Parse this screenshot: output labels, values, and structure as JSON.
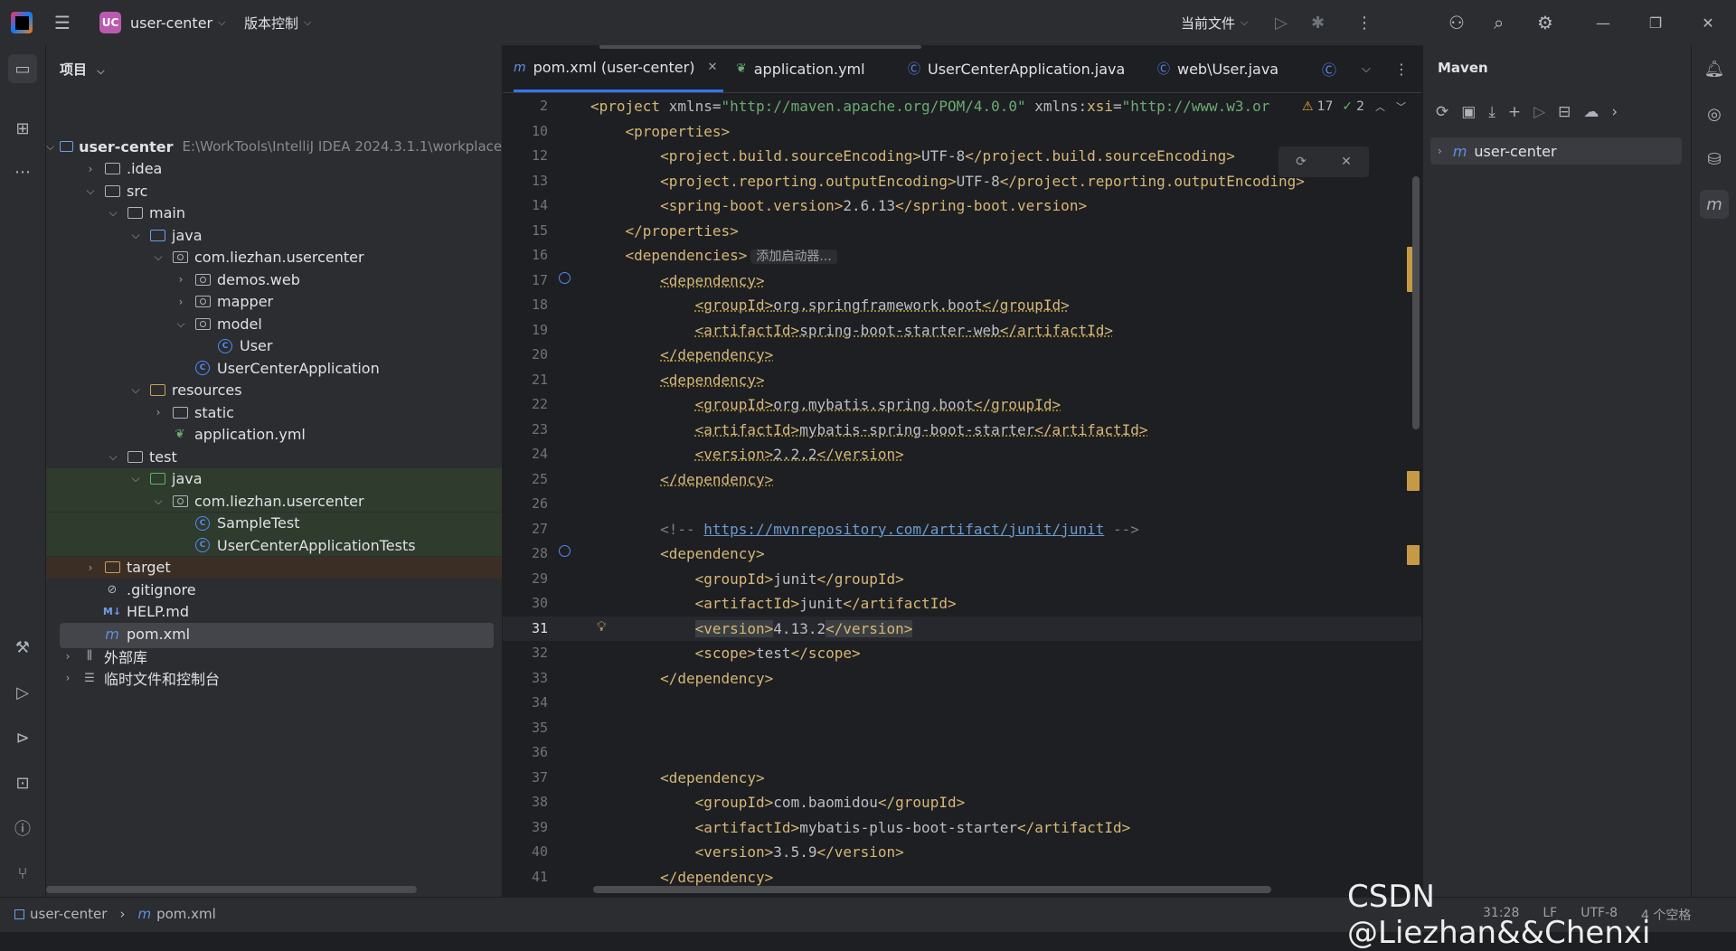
{
  "titlebar": {
    "badge": "UC",
    "project": "user-center",
    "vcs": "版本控制",
    "run_config": "当前文件"
  },
  "project_panel": {
    "header": "项目",
    "tree": [
      {
        "label": "user-center",
        "path": "E:\\WorkTools\\IntelliJ IDEA 2024.3.1.1\\workplace",
        "depth": 0,
        "arrow": "down",
        "icon": "module"
      },
      {
        "label": ".idea",
        "depth": 1,
        "arrow": "right",
        "icon": "folder"
      },
      {
        "label": "src",
        "depth": 1,
        "arrow": "down",
        "icon": "folder"
      },
      {
        "label": "main",
        "depth": 2,
        "arrow": "down",
        "icon": "folder"
      },
      {
        "label": "java",
        "depth": 3,
        "arrow": "down",
        "icon": "folder-blue"
      },
      {
        "label": "com.liezhan.usercenter",
        "depth": 4,
        "arrow": "down",
        "icon": "package"
      },
      {
        "label": "demos.web",
        "depth": 5,
        "arrow": "right",
        "icon": "package"
      },
      {
        "label": "mapper",
        "depth": 5,
        "arrow": "right",
        "icon": "package"
      },
      {
        "label": "model",
        "depth": 5,
        "arrow": "down",
        "icon": "package"
      },
      {
        "label": "User",
        "depth": 6,
        "arrow": "",
        "icon": "class"
      },
      {
        "label": "UserCenterApplication",
        "depth": 5,
        "arrow": "",
        "icon": "spring-class"
      },
      {
        "label": "resources",
        "depth": 3,
        "arrow": "down",
        "icon": "folder-res"
      },
      {
        "label": "static",
        "depth": 4,
        "arrow": "right",
        "icon": "folder"
      },
      {
        "label": "application.yml",
        "depth": 4,
        "arrow": "",
        "icon": "yml"
      },
      {
        "label": "test",
        "depth": 2,
        "arrow": "down",
        "icon": "folder"
      },
      {
        "label": "java",
        "depth": 3,
        "arrow": "down",
        "icon": "folder-green",
        "hl": "test"
      },
      {
        "label": "com.liezhan.usercenter",
        "depth": 4,
        "arrow": "down",
        "icon": "package",
        "hl": "test"
      },
      {
        "label": "SampleTest",
        "depth": 5,
        "arrow": "",
        "icon": "spring-class",
        "hl": "test"
      },
      {
        "label": "UserCenterApplicationTests",
        "depth": 5,
        "arrow": "",
        "icon": "spring-class",
        "hl": "test"
      },
      {
        "label": "target",
        "depth": 1,
        "arrow": "right",
        "icon": "folder-orange",
        "hl": "target"
      },
      {
        "label": ".gitignore",
        "depth": 1,
        "arrow": "",
        "icon": "ignore"
      },
      {
        "label": "HELP.md",
        "depth": 1,
        "arrow": "",
        "icon": "md"
      },
      {
        "label": "pom.xml",
        "depth": 1,
        "arrow": "",
        "icon": "maven",
        "hl": "sel"
      },
      {
        "label": "外部库",
        "depth": 0,
        "arrow": "right",
        "icon": "lib"
      },
      {
        "label": "临时文件和控制台",
        "depth": 0,
        "arrow": "right",
        "icon": "scratch"
      }
    ]
  },
  "editor": {
    "tabs": [
      {
        "label": "pom.xml (user-center)",
        "icon": "m",
        "active": true
      },
      {
        "label": "application.yml",
        "icon": "yml"
      },
      {
        "label": "UserCenterApplication.java",
        "icon": "c"
      },
      {
        "label": "web\\User.java",
        "icon": "c"
      }
    ],
    "inspections": {
      "warnings": "17",
      "ok": "2"
    },
    "inlay_hint": "添加启动器...",
    "current_line": "31",
    "lines": [
      {
        "n": "2",
        "c": [
          [
            "tg",
            "<project "
          ],
          [
            "at",
            "xmlns="
          ],
          [
            "av",
            "\"http://maven.apache.org/POM/4.0.0\""
          ],
          [
            "at",
            " xmlns:"
          ],
          [
            "tg",
            "xsi"
          ],
          [
            "at",
            "="
          ],
          [
            "av",
            "\"http://www.w3.or"
          ]
        ]
      },
      {
        "n": "10",
        "c": [
          [
            "tg",
            "    <properties>"
          ]
        ]
      },
      {
        "n": "12",
        "c": [
          [
            "tg",
            "        <project.build.sourceEncoding>"
          ],
          [
            "tx",
            "UTF-8"
          ],
          [
            "tg",
            "</project.build.sourceEncoding>"
          ]
        ]
      },
      {
        "n": "13",
        "c": [
          [
            "tg",
            "        <project.reporting.outputEncoding>"
          ],
          [
            "tx",
            "UTF-8"
          ],
          [
            "tg",
            "</project.reporting.outputEncoding>"
          ]
        ]
      },
      {
        "n": "14",
        "c": [
          [
            "tg",
            "        <spring-boot.version>"
          ],
          [
            "tx",
            "2.6.13"
          ],
          [
            "tg",
            "</spring-boot.version>"
          ]
        ]
      },
      {
        "n": "15",
        "c": [
          [
            "tg",
            "    </properties>"
          ]
        ]
      },
      {
        "n": "16",
        "c": [
          [
            "tg",
            "    <dependencies>"
          ]
        ],
        "inlay": true
      },
      {
        "n": "17",
        "c": [
          [
            "tg",
            "        "
          ],
          [
            "tg sq",
            "<dependency>"
          ]
        ]
      },
      {
        "n": "18",
        "c": [
          [
            "tg",
            "            "
          ],
          [
            "tg sq",
            "<groupId>"
          ],
          [
            "tx sq",
            "org.springframework.boot"
          ],
          [
            "tg sq",
            "</groupId>"
          ]
        ]
      },
      {
        "n": "19",
        "c": [
          [
            "tg",
            "            "
          ],
          [
            "tg sq",
            "<artifactId>"
          ],
          [
            "tx sq",
            "spring-boot-starter-web"
          ],
          [
            "tg sq",
            "</artifactId>"
          ]
        ]
      },
      {
        "n": "20",
        "c": [
          [
            "tg",
            "        "
          ],
          [
            "tg sq",
            "</dependency>"
          ]
        ]
      },
      {
        "n": "21",
        "c": [
          [
            "tg",
            "        "
          ],
          [
            "tg sq",
            "<dependency>"
          ]
        ]
      },
      {
        "n": "22",
        "c": [
          [
            "tg",
            "            "
          ],
          [
            "tg sq",
            "<groupId>"
          ],
          [
            "tx sq",
            "org.mybatis.spring.boot"
          ],
          [
            "tg sq",
            "</groupId>"
          ]
        ]
      },
      {
        "n": "23",
        "c": [
          [
            "tg",
            "            "
          ],
          [
            "tg sq",
            "<artifactId>"
          ],
          [
            "tx sq",
            "mybatis-spring-boot-starter"
          ],
          [
            "tg sq",
            "</artifactId>"
          ]
        ]
      },
      {
        "n": "24",
        "c": [
          [
            "tg",
            "            "
          ],
          [
            "tg sq",
            "<version>"
          ],
          [
            "tx sq",
            "2.2.2"
          ],
          [
            "tg sq",
            "</version>"
          ]
        ]
      },
      {
        "n": "25",
        "c": [
          [
            "tg",
            "        "
          ],
          [
            "tg sq",
            "</dependency>"
          ]
        ]
      },
      {
        "n": "26",
        "c": []
      },
      {
        "n": "27",
        "c": [
          [
            "cm",
            "        <!-- "
          ],
          [
            "lk",
            "https://mvnrepository.com/artifact/junit/junit"
          ],
          [
            "cm",
            " -->"
          ]
        ]
      },
      {
        "n": "28",
        "c": [
          [
            "tg",
            "        <dependency>"
          ]
        ]
      },
      {
        "n": "29",
        "c": [
          [
            "tg",
            "            <groupId>"
          ],
          [
            "tx",
            "junit"
          ],
          [
            "tg",
            "</groupId>"
          ]
        ]
      },
      {
        "n": "30",
        "c": [
          [
            "tg",
            "            <artifactId>"
          ],
          [
            "tx",
            "junit"
          ],
          [
            "tg",
            "</artifactId>"
          ]
        ]
      },
      {
        "n": "31",
        "c": [
          [
            "tg",
            "            "
          ],
          [
            "tg hlsel",
            "<version>"
          ],
          [
            "tx",
            "4.13.2"
          ],
          [
            "tg hlsel",
            "</version>"
          ]
        ]
      },
      {
        "n": "32",
        "c": [
          [
            "tg",
            "            <scope>"
          ],
          [
            "tx",
            "test"
          ],
          [
            "tg",
            "</scope>"
          ]
        ]
      },
      {
        "n": "33",
        "c": [
          [
            "tg",
            "        </dependency>"
          ]
        ]
      },
      {
        "n": "34",
        "c": []
      },
      {
        "n": "35",
        "c": []
      },
      {
        "n": "36",
        "c": []
      },
      {
        "n": "37",
        "c": [
          [
            "tg",
            "        <dependency>"
          ]
        ]
      },
      {
        "n": "38",
        "c": [
          [
            "tg",
            "            <groupId>"
          ],
          [
            "tx",
            "com.baomidou"
          ],
          [
            "tg",
            "</groupId>"
          ]
        ]
      },
      {
        "n": "39",
        "c": [
          [
            "tg",
            "            <artifactId>"
          ],
          [
            "tx",
            "mybatis-plus-boot-starter"
          ],
          [
            "tg",
            "</artifactId>"
          ]
        ]
      },
      {
        "n": "40",
        "c": [
          [
            "tg",
            "            <version>"
          ],
          [
            "tx",
            "3.5.9"
          ],
          [
            "tg",
            "</version>"
          ]
        ]
      },
      {
        "n": "41",
        "c": [
          [
            "tg",
            "        </dependency>"
          ]
        ]
      }
    ]
  },
  "maven": {
    "title": "Maven",
    "root": "user-center"
  },
  "statusbar": {
    "crumb1": "user-center",
    "crumb2": "pom.xml",
    "position": "31:28",
    "eol": "LF",
    "encoding": "UTF-8",
    "indent": "4 个空格"
  },
  "watermark": "CSDN @Liezhan&&Chenxi"
}
